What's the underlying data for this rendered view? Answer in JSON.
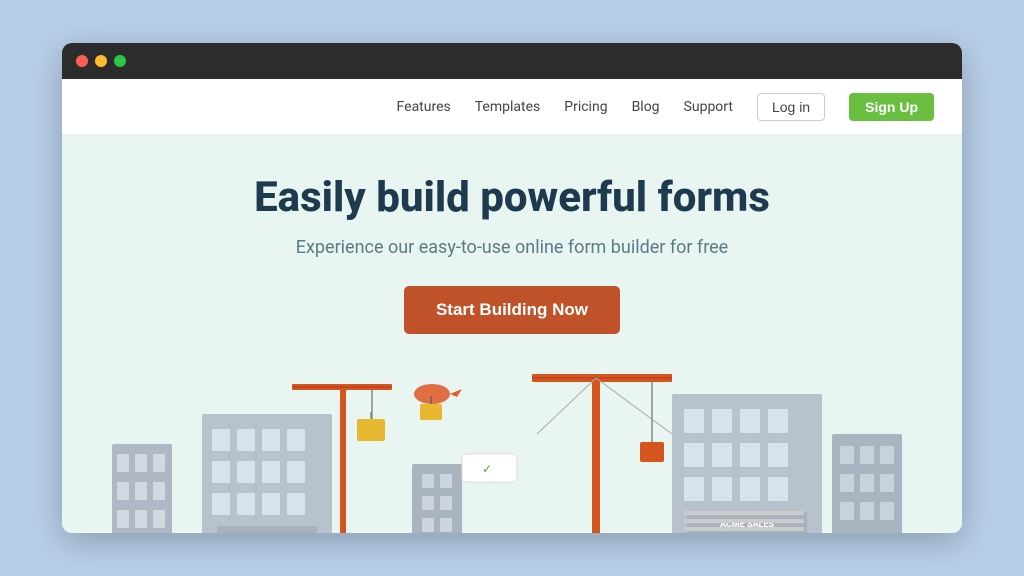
{
  "browser": {
    "dots": [
      "red",
      "yellow",
      "green"
    ]
  },
  "navbar": {
    "links": [
      {
        "label": "Features",
        "name": "features-link"
      },
      {
        "label": "Templates",
        "name": "templates-link"
      },
      {
        "label": "Pricing",
        "name": "pricing-link"
      },
      {
        "label": "Blog",
        "name": "blog-link"
      },
      {
        "label": "Support",
        "name": "support-link"
      }
    ],
    "login_label": "Log in",
    "signup_label": "Sign Up"
  },
  "hero": {
    "title": "Easily build powerful forms",
    "subtitle": "Experience our easy-to-use online form builder for free",
    "cta_label": "Start Building Now"
  },
  "colors": {
    "bg": "#b8cfe8",
    "hero_bg": "#e8f5f0",
    "cta_bg": "#c0522a",
    "signup_bg": "#6abf40",
    "title_color": "#1e3a4f",
    "subtitle_color": "#5a7a8a"
  }
}
